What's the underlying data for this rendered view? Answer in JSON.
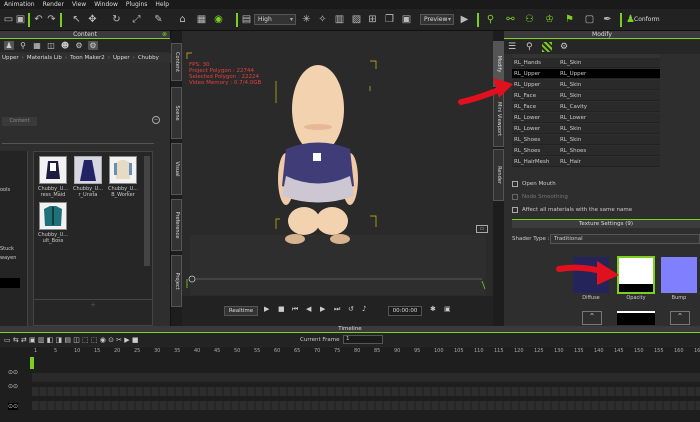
{
  "menubar": {
    "items": [
      "Animation",
      "Render",
      "View",
      "Window",
      "Plugins",
      "Help"
    ]
  },
  "toolbar": {
    "quality": "High",
    "preview": "Preview",
    "conform_label": "Conform"
  },
  "content": {
    "title": "Content",
    "breadcrumb": [
      "Upper",
      "Materials Lib",
      "Toon Maker2",
      "Upper",
      "Chubby"
    ],
    "placeholder": "Content",
    "thumbs": [
      {
        "label": "Chubby_U...\nress_Maid"
      },
      {
        "label": "Chubby_U...\nr_Unsta"
      },
      {
        "label": "Chubby_U...\nB_Worker"
      },
      {
        "label": "Chubby_U...\nult_Boss"
      }
    ],
    "left_items": [
      "ools",
      "Stuck",
      "wayen"
    ]
  },
  "left_vtabs": [
    "Content",
    "Scene",
    "Visual",
    "Preference",
    "Project"
  ],
  "right_vtabs": [
    "Modify",
    "Mini Viewport",
    "Render"
  ],
  "viewport": {
    "stats": [
      "FPS: 30",
      "Project Polygon : 22744",
      "Selected Polygon : 22224",
      "Video Memory : 0.7/4.0GB"
    ],
    "realtime_label": "Realtime",
    "timecode": "00:00:00"
  },
  "modify": {
    "title": "Modify",
    "rows": [
      {
        "a": "RL_Hands",
        "b": "RL_Skin"
      },
      {
        "a": "RL_Upper",
        "b": "RL_Upper",
        "selected": true
      },
      {
        "a": "RL_Upper",
        "b": "RL_Skin"
      },
      {
        "a": "RL_Face",
        "b": "RL_Skin"
      },
      {
        "a": "RL_Face",
        "b": "RL_Cavity"
      },
      {
        "a": "RL_Lower",
        "b": "RL_Lower"
      },
      {
        "a": "RL_Lower",
        "b": "RL_Skin"
      },
      {
        "a": "RL_Shoes",
        "b": "RL_Skin"
      },
      {
        "a": "RL_Shoes",
        "b": "RL_Shoes"
      },
      {
        "a": "RL_HairMesh",
        "b": "RL_Hair"
      }
    ],
    "open_mouth": "Open Mouth",
    "smooth": "Node Smoothing",
    "affect_all": "Affect all materials with the same name",
    "texture_settings": "Texture Settings  (9)",
    "shader_type_label": "Shader Type :",
    "shader_type": "Traditional",
    "channels": [
      "Diffuse",
      "Opacity",
      "Bump"
    ]
  },
  "timeline": {
    "title": "Timeline",
    "current_frame_label": "Current Frame",
    "current_frame": "1",
    "ticks": [
      "1",
      "5",
      "10",
      "15",
      "20",
      "25",
      "30",
      "35",
      "40",
      "45",
      "50",
      "55",
      "60",
      "65",
      "70",
      "75",
      "80",
      "85",
      "90",
      "95",
      "100",
      "105",
      "110",
      "115",
      "120",
      "125",
      "130",
      "135",
      "140",
      "145",
      "150",
      "155",
      "160",
      "165"
    ]
  },
  "colors": {
    "accent": "#7ccf1f",
    "stats": "#e24141",
    "arrow": "#e0101e"
  }
}
